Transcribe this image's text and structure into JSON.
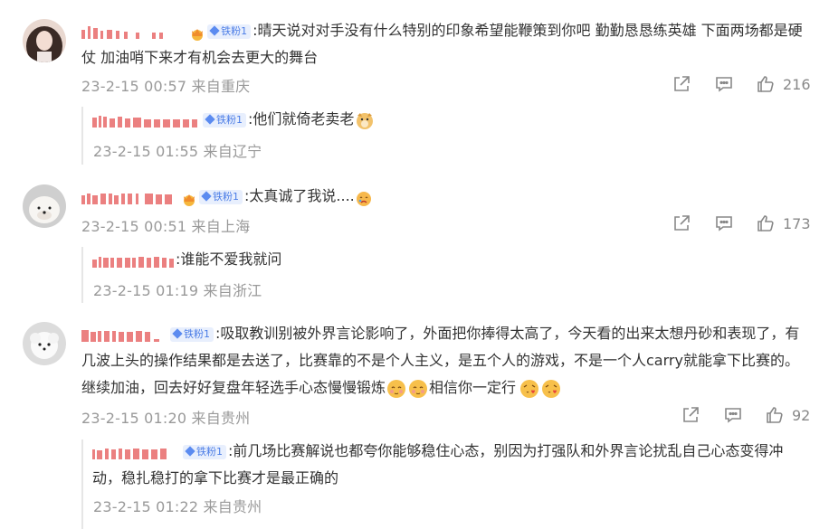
{
  "colors": {
    "text": "#333333",
    "meta": "#999999",
    "username": "#e86b6b",
    "badge_bg": "#e8effd",
    "badge_text": "#4a7ce6"
  },
  "comments": [
    {
      "text": ":晴天说对对手没有什么特别的印象希望能鞭策到你吧 勤勤恳恳练英雄 下面两场都是硬仗 加油哨下来才有机会去更大的舞台",
      "badge": "铁粉1",
      "time": "23-2-15 00:57",
      "location": "来自重庆",
      "likes": "216",
      "reply": {
        "text": ":他们就倚老卖老",
        "badge": "铁粉1",
        "time": "23-2-15 01:55",
        "location": "来自辽宁"
      }
    },
    {
      "text": ":太真诚了我说....",
      "badge": "铁粉1",
      "time": "23-2-15 00:51",
      "location": "来自上海",
      "likes": "173",
      "reply": {
        "text": ":谁能不爱我就问",
        "time": "23-2-15 01:19",
        "location": "来自浙江"
      }
    },
    {
      "text_a": ":吸取教训别被外界言论影响了，外面把你捧得太高了，今天看的出来太想丹砂和表现了，有几波上头的操作结果都是去送了，比赛靠的不是个人主义，是五个人的游戏，不是一个人carry就能拿下比赛的。继续加油，回去好好复盘年轻选手心态慢慢锻炼",
      "text_b": "相信你一定行",
      "badge": "铁粉1",
      "time": "23-2-15 01:20",
      "location": "来自贵州",
      "likes": "92",
      "reply": {
        "text": ":前几场比赛解说也都夸你能够稳住心态，别因为打强队和外界言论扰乱自己心态变得冲动，稳扎稳打的拿下比赛才是最正确的",
        "badge": "铁粉1",
        "time": "23-2-15 01:22",
        "location": "来自贵州"
      }
    }
  ],
  "icons": [
    "share-icon",
    "comment-icon",
    "like-icon",
    "crown-icon",
    "doge-emoji",
    "cry-emoji",
    "shy-emoji",
    "kiss-emoji",
    "diamond-icon"
  ]
}
